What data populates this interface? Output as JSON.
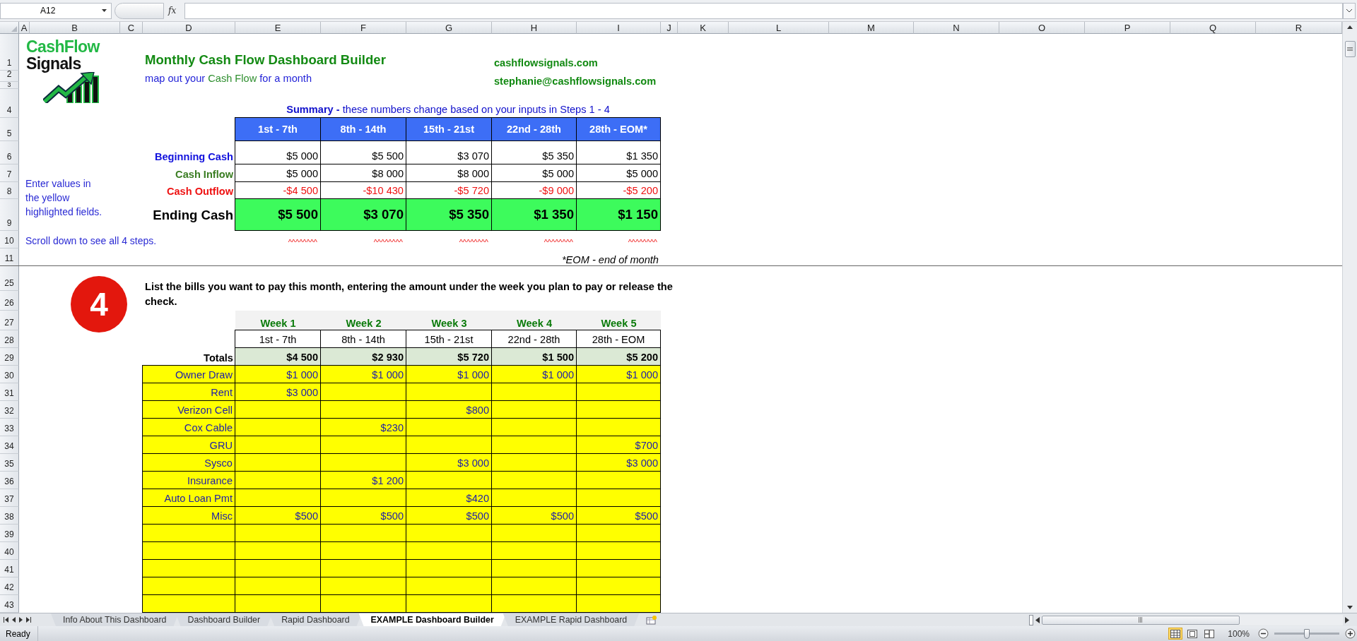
{
  "formula_bar": {
    "name_box": "A12",
    "function_label": "fx"
  },
  "column_headers": [
    "A",
    "B",
    "C",
    "D",
    "E",
    "F",
    "G",
    "H",
    "I",
    "J",
    "K",
    "L",
    "M",
    "N",
    "O",
    "P",
    "Q",
    "R"
  ],
  "row_headers": [
    "1",
    "2",
    "3",
    "4",
    "5",
    "6",
    "7",
    "8",
    "9",
    "10",
    "11",
    "25",
    "26",
    "27",
    "28",
    "29",
    "30",
    "31",
    "32",
    "33",
    "34",
    "35",
    "36",
    "37",
    "38",
    "39",
    "40",
    "41",
    "42",
    "43"
  ],
  "logo": {
    "line_1": "CashFlow",
    "line_2": "Signals"
  },
  "title": "Monthly Cash Flow Dashboard Builder",
  "subtitle": [
    {
      "text": "map out your ",
      "accent": false
    },
    {
      "text": "Cash Flow",
      "accent": true
    },
    {
      "text": " for a month",
      "accent": false
    }
  ],
  "website": "cashflowsignals.com",
  "email": "stephanie@cashflowsignals.com",
  "summary": {
    "note": "**Summary -** these numbers change based on your inputs in Steps 1 - 4",
    "columns": [
      "1st - 7th",
      "8th - 14th",
      "15th - 21st",
      "22nd - 28th",
      "28th - EOM*"
    ],
    "rows": [
      {
        "kind": "beginning",
        "label": "Beginning Cash",
        "values": [
          "$5 000",
          "$5 500",
          "$3 070",
          "$5 350",
          "$1 350"
        ]
      },
      {
        "kind": "inflow",
        "label": "Cash Inflow",
        "values": [
          "$5 000",
          "$8 000",
          "$8 000",
          "$5 000",
          "$5 000"
        ]
      },
      {
        "kind": "outflow",
        "label": "Cash Outflow",
        "values": [
          "-$4 500",
          "-$10 430",
          "-$5 720",
          "-$9 000",
          "-$5 200"
        ]
      },
      {
        "kind": "ending",
        "label": "Ending Cash",
        "values": [
          "$5 500",
          "$3 070",
          "$5 350",
          "$1 350",
          "$1 150"
        ]
      }
    ],
    "markers": [
      "^^^^^^^^",
      "^^^^^^^^",
      "^^^^^^^^",
      "^^^^^^^^",
      "^^^^^^^^"
    ],
    "footnote": "*EOM - end of month"
  },
  "side_note": [
    "Enter values in",
    "the yellow",
    "highlighted fields."
  ],
  "scroll_note": "Scroll down to see all 4 steps.",
  "step": {
    "number": "4",
    "instruction": "List the bills you want to pay this month, entering the amount under the week you plan to pay or release the check.",
    "totals_label": "Totals",
    "weeks": [
      {
        "name": "Week 1",
        "dates": "1st - 7th",
        "total": "$4 500"
      },
      {
        "name": "Week 2",
        "dates": "8th - 14th",
        "total": "$2 930"
      },
      {
        "name": "Week 3",
        "dates": "15th - 21st",
        "total": "$5 720"
      },
      {
        "name": "Week 4",
        "dates": "22nd - 28th",
        "total": "$1 500"
      },
      {
        "name": "Week 5",
        "dates": "28th - EOM",
        "total": "$5 200"
      }
    ],
    "bills": [
      {
        "name": "Owner Draw",
        "amounts": {
          "week_1": "$1 000",
          "week_2": "$1 000",
          "week_3": "$1 000",
          "week_4": "$1 000",
          "week_5": "$1 000"
        }
      },
      {
        "name": "Rent",
        "amounts": {
          "week_1": "$3 000"
        }
      },
      {
        "name": "Verizon Cell",
        "amounts": {
          "week_3": "$800"
        }
      },
      {
        "name": "Cox Cable",
        "amounts": {
          "week_2": "$230"
        }
      },
      {
        "name": "GRU",
        "amounts": {
          "week_5": "$700"
        }
      },
      {
        "name": "Sysco",
        "amounts": {
          "week_3": "$3 000",
          "week_5": "$3 000"
        }
      },
      {
        "name": "Insurance",
        "amounts": {
          "week_2": "$1 200"
        }
      },
      {
        "name": "Auto Loan Pmt",
        "amounts": {
          "week_3": "$420"
        }
      },
      {
        "name": "Misc",
        "amounts": {
          "week_1": "$500",
          "week_2": "$500",
          "week_3": "$500",
          "week_4": "$500",
          "week_5": "$500"
        }
      }
    ]
  },
  "sheet_tabs": [
    {
      "label": "Info About This Dashboard",
      "selected": false
    },
    {
      "label": "Dashboard Builder",
      "selected": false
    },
    {
      "label": "Rapid Dashboard",
      "selected": false
    },
    {
      "label": "EXAMPLE Dashboard Builder",
      "selected": true
    },
    {
      "label": "EXAMPLE Rapid Dashboard",
      "selected": false
    }
  ],
  "status_bar": {
    "status": "Ready",
    "views": [
      {
        "kind": "normal",
        "selected": true
      },
      {
        "kind": "page_layout",
        "selected": false
      },
      {
        "kind": "page_break",
        "selected": false
      }
    ],
    "zoom": "100%",
    "zoom_slider": {
      "level": 0.5
    }
  }
}
